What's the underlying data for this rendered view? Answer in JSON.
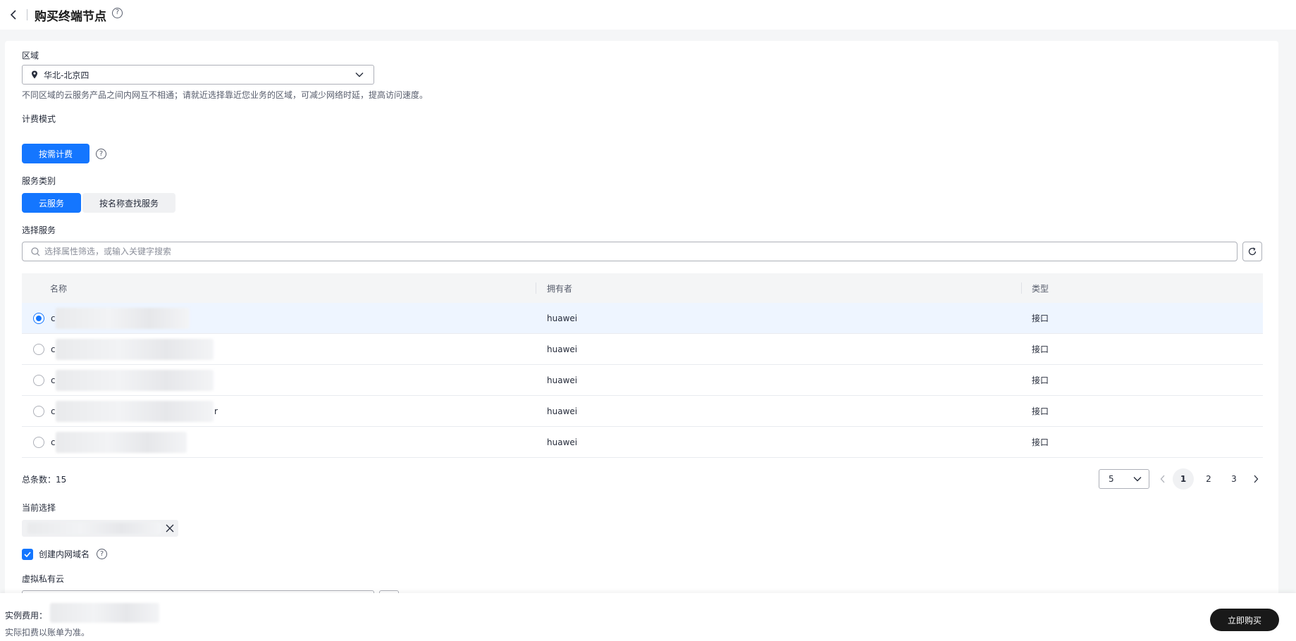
{
  "header": {
    "title": "购买终端节点"
  },
  "region": {
    "label": "区域",
    "value": "华北-北京四",
    "hint": "不同区域的云服务产品之间内网互不相通；请就近选择靠近您业务的区域，可减少网络时延，提高访问速度。"
  },
  "billing": {
    "label": "计费模式",
    "option": "按需计费"
  },
  "service_category": {
    "label": "服务类别",
    "options": [
      "云服务",
      "按名称查找服务"
    ],
    "selected": "云服务"
  },
  "select_service": {
    "label": "选择服务",
    "search_placeholder": "选择属性筛选，或输入关键字搜索"
  },
  "table": {
    "columns": [
      "名称",
      "拥有者",
      "类型"
    ],
    "rows": [
      {
        "name": "c",
        "owner": "huawei",
        "type": "接口",
        "selected": true
      },
      {
        "name": "c",
        "owner": "huawei",
        "type": "接口",
        "selected": false
      },
      {
        "name": "c",
        "owner": "huawei",
        "type": "接口",
        "selected": false
      },
      {
        "name": "c",
        "name_tail": "r",
        "owner": "huawei",
        "type": "接口",
        "selected": false
      },
      {
        "name": "c",
        "owner": "huawei",
        "type": "接口",
        "selected": false
      }
    ]
  },
  "pagination": {
    "total_label": "总条数：15",
    "page_size": "5",
    "pages": [
      "1",
      "2",
      "3"
    ],
    "current_page": "1"
  },
  "current_selection": {
    "label": "当前选择"
  },
  "private_dns": {
    "label": "创建内网域名",
    "checked": true
  },
  "vpc": {
    "label": "虚拟私有云"
  },
  "footer": {
    "fee_label": "实例费用：",
    "note": "实际扣费以账单为准。",
    "buy_label": "立即购买"
  },
  "colors": {
    "primary": "#1476ff",
    "buy_button": "#191919",
    "selected_row": "#eef5ff"
  },
  "icons": [
    "back-arrow-icon",
    "help-icon",
    "location-pin-icon",
    "chevron-down-icon",
    "search-icon",
    "refresh-icon",
    "chevron-left-icon",
    "chevron-right-icon",
    "close-icon",
    "check-icon"
  ]
}
